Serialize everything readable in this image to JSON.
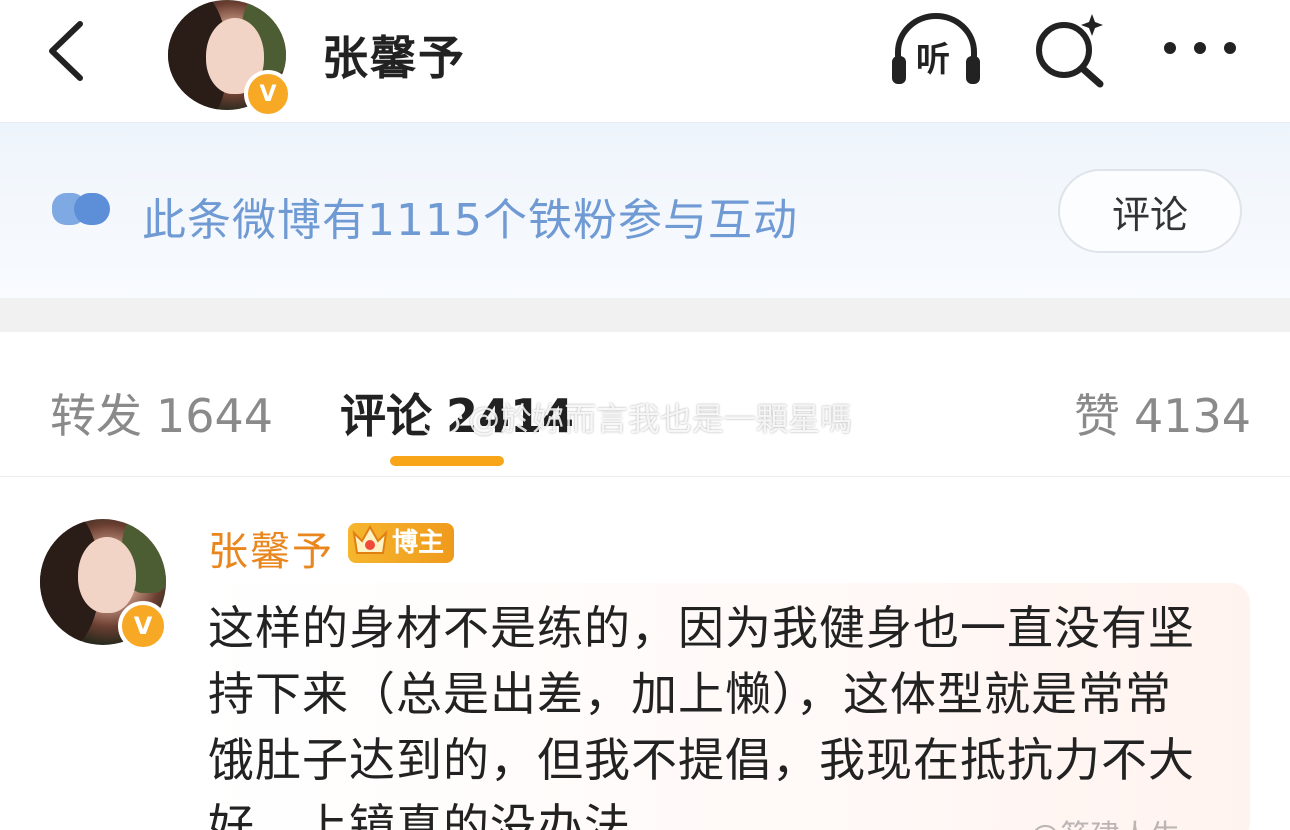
{
  "header": {
    "title": "张馨予",
    "verified_badge": "V",
    "icons": [
      "back-icon",
      "listen-icon",
      "search-icon",
      "more-icon"
    ],
    "listen_label": "听"
  },
  "banner": {
    "text": "此条微博有1115个铁粉参与互动",
    "button_label": "评论",
    "text_color": "#6f9ad3"
  },
  "tabs": {
    "repost_label": "转发",
    "repost_count": "1644",
    "comments_label": "评论",
    "comments_count": "2414",
    "likes_label": "赞",
    "likes_count": "4134",
    "active_color": "#f9a51a"
  },
  "watermark": {
    "text": "@於妳而言我也是一顆星嗎"
  },
  "comment": {
    "username": "张馨予",
    "verified_badge": "V",
    "role_badge": "博主",
    "username_color": "#e9861d",
    "text": "这样的身材不是练的，因为我健身也一直没有坚持下来（总是出差，加上懒），这体型就是常常饿肚子达到的，但我不提倡，我现在抵抗力不大好，上镜真的没办法",
    "corner_watermark": "@箭建人生"
  }
}
